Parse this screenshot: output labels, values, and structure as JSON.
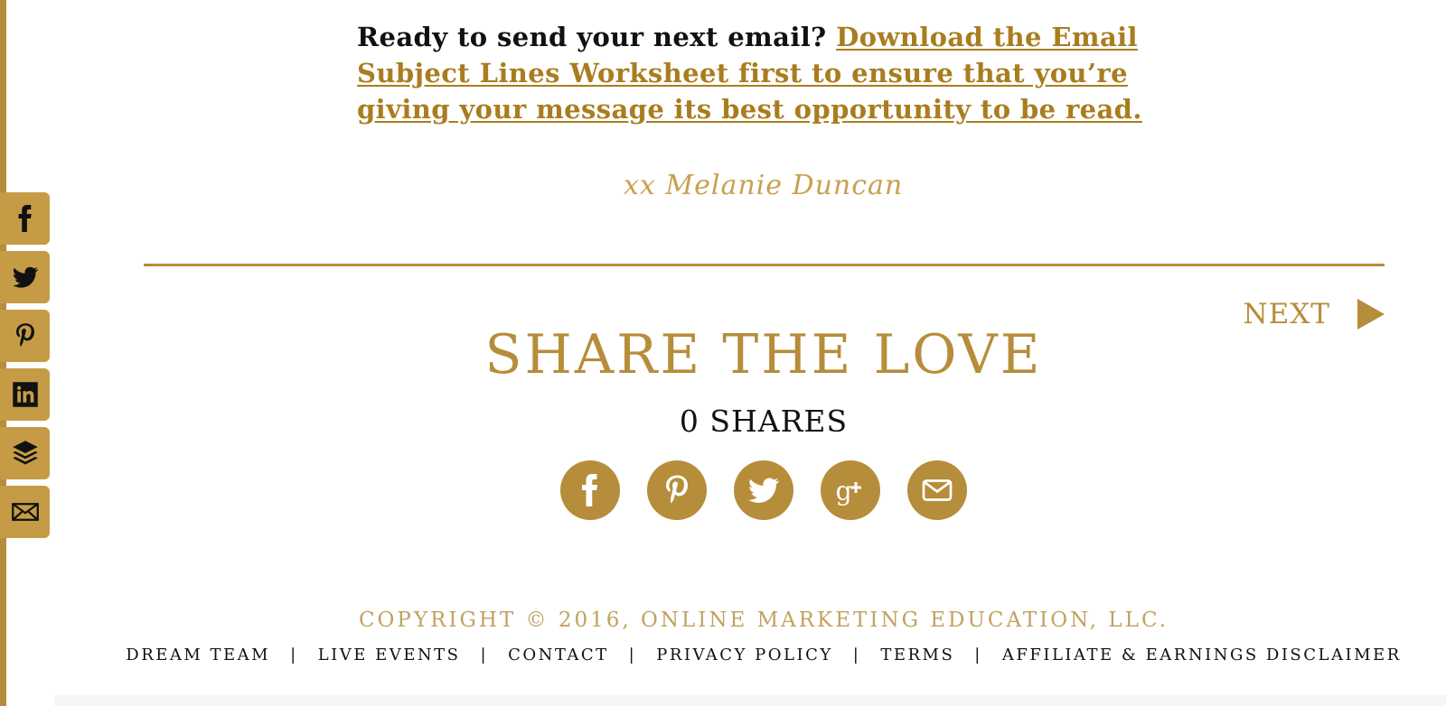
{
  "intro": {
    "lead": "Ready to send your next email?",
    "link": "Download the Email Subject Lines Worksheet first to ensure that you’re giving your message its best opportunity to be read."
  },
  "signature": "xx Melanie Duncan",
  "share_rail": {
    "icons": [
      "facebook-icon",
      "twitter-icon",
      "pinterest-icon",
      "linkedin-icon",
      "buffer-icon",
      "email-icon"
    ]
  },
  "next": {
    "label": "NEXT"
  },
  "share": {
    "title": "SHARE THE LOVE",
    "count": "0 SHARES",
    "icons": [
      "facebook-icon",
      "pinterest-icon",
      "twitter-icon",
      "google-plus-icon",
      "email-icon"
    ]
  },
  "footer": {
    "copyright": "COPYRIGHT © 2016, ONLINE MARKETING EDUCATION, LLC.",
    "links": [
      "DREAM TEAM",
      "LIVE EVENTS",
      "CONTACT",
      "PRIVACY POLICY",
      "TERMS",
      "AFFILIATE & EARNINGS DISCLAIMER"
    ],
    "separator": "|"
  },
  "colors": {
    "accent": "#b68d3a",
    "rail": "#c59c45",
    "link": "#a97d1f",
    "text": "#111111"
  }
}
